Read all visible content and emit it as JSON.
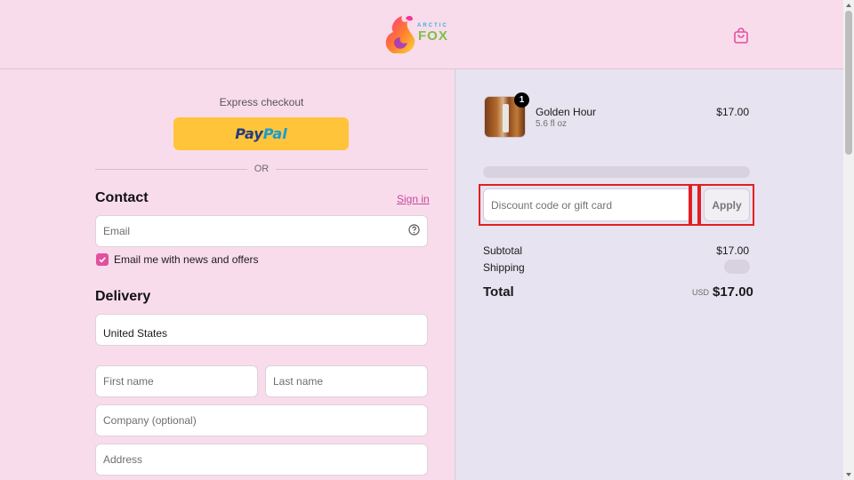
{
  "header": {
    "logo_top": "ARCTIC",
    "logo_bottom": "FOX",
    "cart_icon": "shopping-bag-icon"
  },
  "express": {
    "label": "Express checkout",
    "paypal_pay": "Pay",
    "paypal_pal": "Pal",
    "or": "OR"
  },
  "contact": {
    "title": "Contact",
    "signin": "Sign in",
    "email_placeholder": "Email",
    "newsletter_label": "Email me with news and offers",
    "newsletter_checked": true
  },
  "delivery": {
    "title": "Delivery",
    "country": "United States",
    "first_name_placeholder": "First name",
    "last_name_placeholder": "Last name",
    "company_placeholder": "Company (optional)",
    "address_placeholder": "Address"
  },
  "summary": {
    "item": {
      "name": "Golden Hour",
      "variant": "5.6 fl oz",
      "price": "$17.00",
      "quantity": "1"
    },
    "discount_placeholder": "Discount code or gift card",
    "apply_label": "Apply",
    "subtotal_label": "Subtotal",
    "subtotal_value": "$17.00",
    "shipping_label": "Shipping",
    "total_label": "Total",
    "total_currency": "USD",
    "total_value": "$17.00"
  },
  "colors": {
    "page_bg": "#f9dcec",
    "summary_bg": "#e8e3f0",
    "accent": "#e0519e",
    "paypal_yellow": "#ffc439",
    "highlight": "#e02020"
  }
}
